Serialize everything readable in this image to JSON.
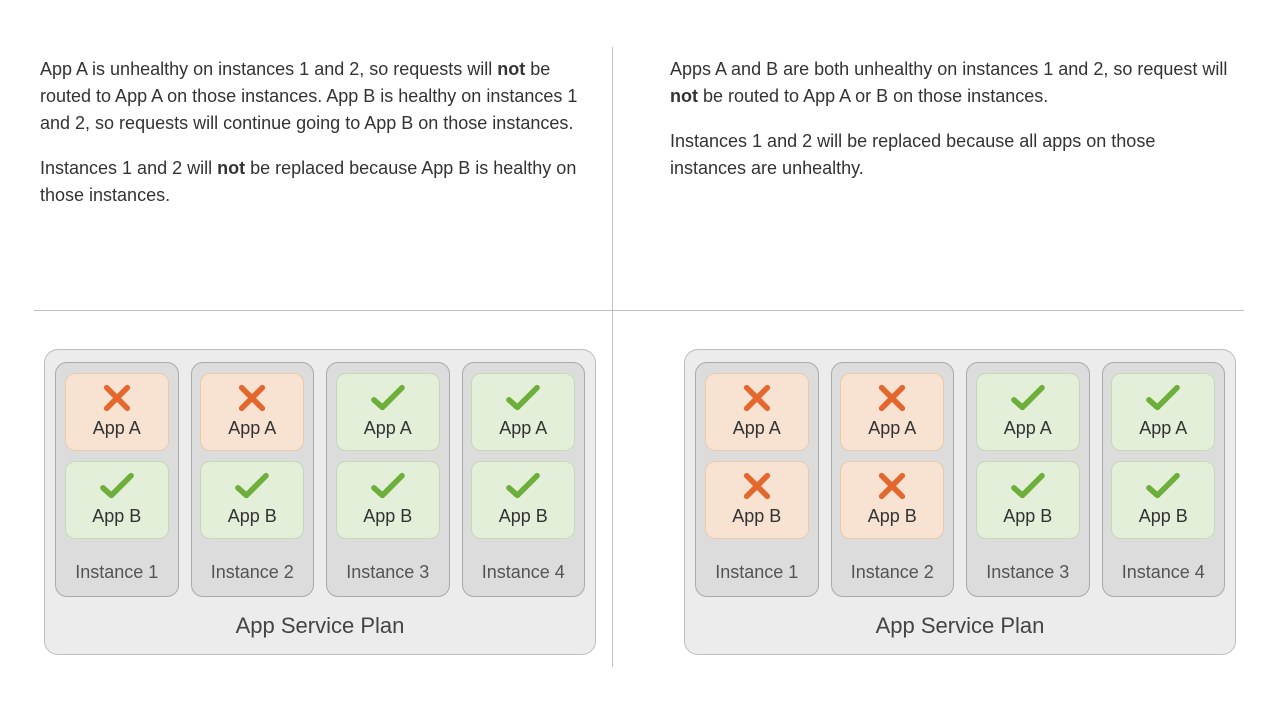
{
  "left": {
    "para1_a": "App A is unhealthy on instances 1 and 2, so requests will ",
    "para1_b": "not",
    "para1_c": " be routed to App A on those instances. App B is healthy on instances 1 and 2, so requests will continue going to App B on those instances.",
    "para2_a": "Instances 1 and 2 will ",
    "para2_b": "not",
    "para2_c": " be replaced because App B is healthy on those instances."
  },
  "right": {
    "para1_a": "Apps A and B are both unhealthy on instances 1 and 2, so request will ",
    "para1_b": "not",
    "para1_c": " be routed to App A or B on those instances.",
    "para2": "Instances 1 and 2 will be replaced because all apps on those instances are unhealthy."
  },
  "labels": {
    "appA": "App A",
    "appB": "App B",
    "inst1": "Instance 1",
    "inst2": "Instance 2",
    "inst3": "Instance 3",
    "inst4": "Instance 4",
    "plan": "App Service Plan"
  },
  "chart_data": [
    {
      "type": "table",
      "title": "Scenario 1 – App A unhealthy on instances 1 & 2",
      "categories": [
        "Instance 1",
        "Instance 2",
        "Instance 3",
        "Instance 4"
      ],
      "series": [
        {
          "name": "App A",
          "values": [
            "unhealthy",
            "unhealthy",
            "healthy",
            "healthy"
          ]
        },
        {
          "name": "App B",
          "values": [
            "healthy",
            "healthy",
            "healthy",
            "healthy"
          ]
        }
      ],
      "instances_replaced": []
    },
    {
      "type": "table",
      "title": "Scenario 2 – Apps A and B unhealthy on instances 1 & 2",
      "categories": [
        "Instance 1",
        "Instance 2",
        "Instance 3",
        "Instance 4"
      ],
      "series": [
        {
          "name": "App A",
          "values": [
            "unhealthy",
            "unhealthy",
            "healthy",
            "healthy"
          ]
        },
        {
          "name": "App B",
          "values": [
            "unhealthy",
            "unhealthy",
            "healthy",
            "healthy"
          ]
        }
      ],
      "instances_replaced": [
        "Instance 1",
        "Instance 2"
      ]
    }
  ]
}
